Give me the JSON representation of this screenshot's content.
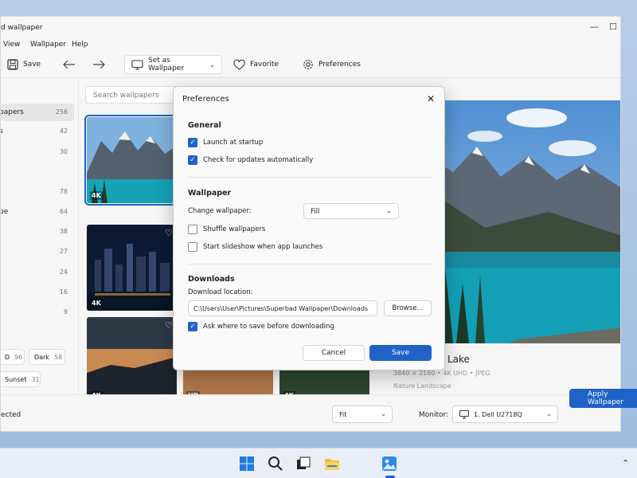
{
  "window": {
    "title": "d wallpaper"
  },
  "menu": [
    "View",
    "Wallpaper",
    "Help"
  ],
  "toolbar": {
    "save": "Save",
    "set_as": "Set as Wallpaper",
    "favorite": "Favorite",
    "preferences": "Preferences"
  },
  "sidebar": {
    "items": [
      {
        "label": "papers",
        "count": "256"
      },
      {
        "label": "s",
        "count": "42"
      },
      {
        "label": "",
        "count": "30"
      },
      {
        "label": "",
        "count": "78"
      },
      {
        "label": "pe",
        "count": "64"
      },
      {
        "label": "",
        "count": "38"
      },
      {
        "label": "",
        "count": "27"
      },
      {
        "label": "",
        "count": "24"
      },
      {
        "label": "",
        "count": "16"
      },
      {
        "label": "",
        "count": "9"
      }
    ],
    "chips": [
      {
        "label": "D",
        "count": "96"
      },
      {
        "label": "Dark",
        "count": "58"
      },
      {
        "label": "Sunset",
        "count": "31"
      }
    ]
  },
  "grid": {
    "search_placeholder": "Search wallpapers",
    "thumbs": [
      {
        "badge": "4K"
      },
      {
        "badge": "4K"
      },
      {
        "badge": "4K"
      },
      {
        "badge": "4K"
      },
      {
        "badge": "HD"
      },
      {
        "badge": "4K"
      }
    ]
  },
  "preview": {
    "title": "Lake",
    "meta": "3840 × 2160  •  4K UHD  •  JPEG",
    "tags": "Nature     Landscape"
  },
  "statusbar": {
    "text": "ected",
    "fit": "Fit",
    "monitor_label": "Monitor:",
    "monitor": "1. Dell U2718Q",
    "apply": "Apply Wallpaper"
  },
  "dialog": {
    "title": "Preferences",
    "general": "General",
    "launch": "Launch at startup",
    "updates": "Check for updates automatically",
    "wallpaper": "Wallpaper",
    "change_label": "Change wallpaper:",
    "change_value": "Fill",
    "shuffle": "Shuffle wallpapers",
    "slideshow": "Start slideshow when app launches",
    "downloads": "Downloads",
    "location_label": "Download location:",
    "location_value": "C:\\Users\\User\\Pictures\\Superbad Wallpaper\\Downloads",
    "browse": "Browse...",
    "ask": "Ask where to save before downloading",
    "cancel": "Cancel",
    "save": "Save"
  },
  "colors": {
    "accent": "#1f63c7"
  }
}
